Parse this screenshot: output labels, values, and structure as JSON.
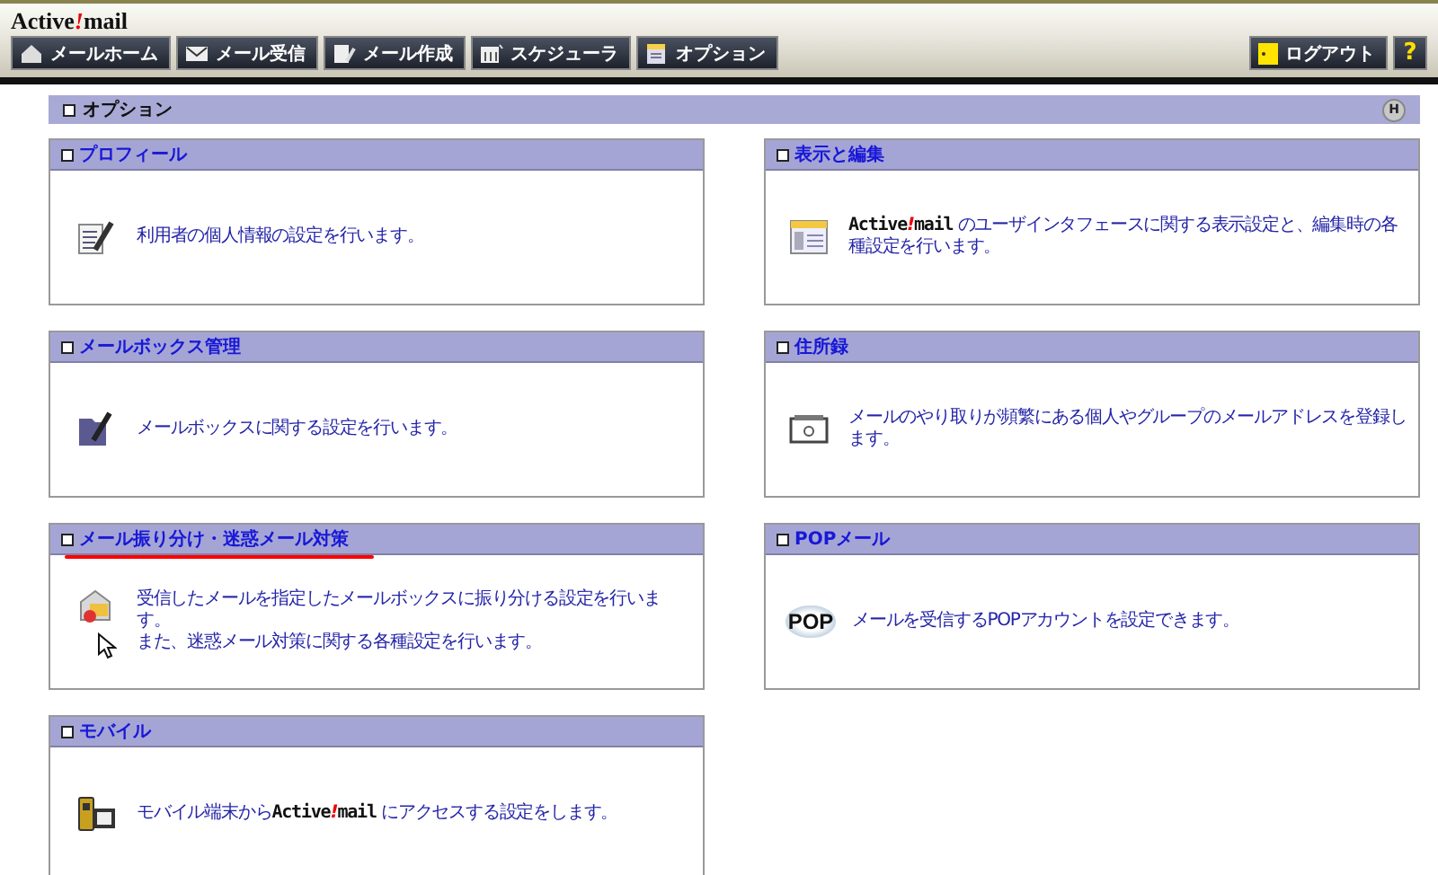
{
  "logo": {
    "parts": [
      "Active",
      "!",
      "mail"
    ]
  },
  "toolbar": [
    {
      "label": "メールホーム",
      "kind": "home"
    },
    {
      "label": "メール受信",
      "kind": "inbox"
    },
    {
      "label": "メール作成",
      "kind": "compose"
    },
    {
      "label": "スケジューラ",
      "kind": "calendar"
    },
    {
      "label": "オプション",
      "kind": "options"
    }
  ],
  "logout": {
    "label": "ログアウト"
  },
  "help": {
    "label": "?"
  },
  "section": {
    "title": "オプション",
    "badge": "H"
  },
  "columns": [
    [
      {
        "title": "プロフィール",
        "kind": "profile",
        "underlined": false,
        "pointer": false,
        "lines": [
          [
            {
              "kind": "text",
              "text": "利用者の個人情報の設定を行います。"
            }
          ]
        ]
      },
      {
        "title": "メールボックス管理",
        "kind": "mailbox",
        "underlined": false,
        "pointer": false,
        "lines": [
          [
            {
              "kind": "text",
              "text": "メールボックスに関する設定を行います。"
            }
          ]
        ]
      },
      {
        "title": "メール振り分け・迷惑メール対策",
        "kind": "filter",
        "underlined": true,
        "pointer": true,
        "lines": [
          [
            {
              "kind": "text",
              "text": "受信したメールを指定したメールボックスに振り分ける設定を行います。"
            }
          ],
          [
            {
              "kind": "text",
              "text": "また、迷惑メール対策に関する各種設定を行います。"
            }
          ]
        ]
      },
      {
        "title": "モバイル",
        "kind": "mobile",
        "underlined": false,
        "pointer": false,
        "lines": [
          [
            {
              "kind": "text",
              "text": "モバイル端末から"
            },
            {
              "kind": "brand",
              "parts": [
                "Active",
                "!",
                "mail"
              ]
            },
            {
              "kind": "text",
              "text": " にアクセスする設定をします。"
            }
          ]
        ]
      }
    ],
    [
      {
        "title": "表示と編集",
        "kind": "display",
        "underlined": false,
        "pointer": false,
        "lines": [
          [
            {
              "kind": "brand",
              "parts": [
                "Active",
                "!",
                "mail"
              ]
            },
            {
              "kind": "text",
              "text": " のユーザインタフェースに関する表示設定と、編集時の各種設定を行います。"
            }
          ]
        ]
      },
      {
        "title": "住所録",
        "kind": "address",
        "underlined": false,
        "pointer": false,
        "lines": [
          [
            {
              "kind": "text",
              "text": "メールのやり取りが頻繁にある個人やグループのメールアドレスを登録します。"
            }
          ]
        ]
      },
      {
        "title": "POPメール",
        "kind": "pop",
        "icon_text": "POP",
        "underlined": false,
        "pointer": false,
        "lines": [
          [
            {
              "kind": "text",
              "text": "メールを受信するPOPアカウントを設定できます。"
            }
          ]
        ]
      }
    ]
  ]
}
